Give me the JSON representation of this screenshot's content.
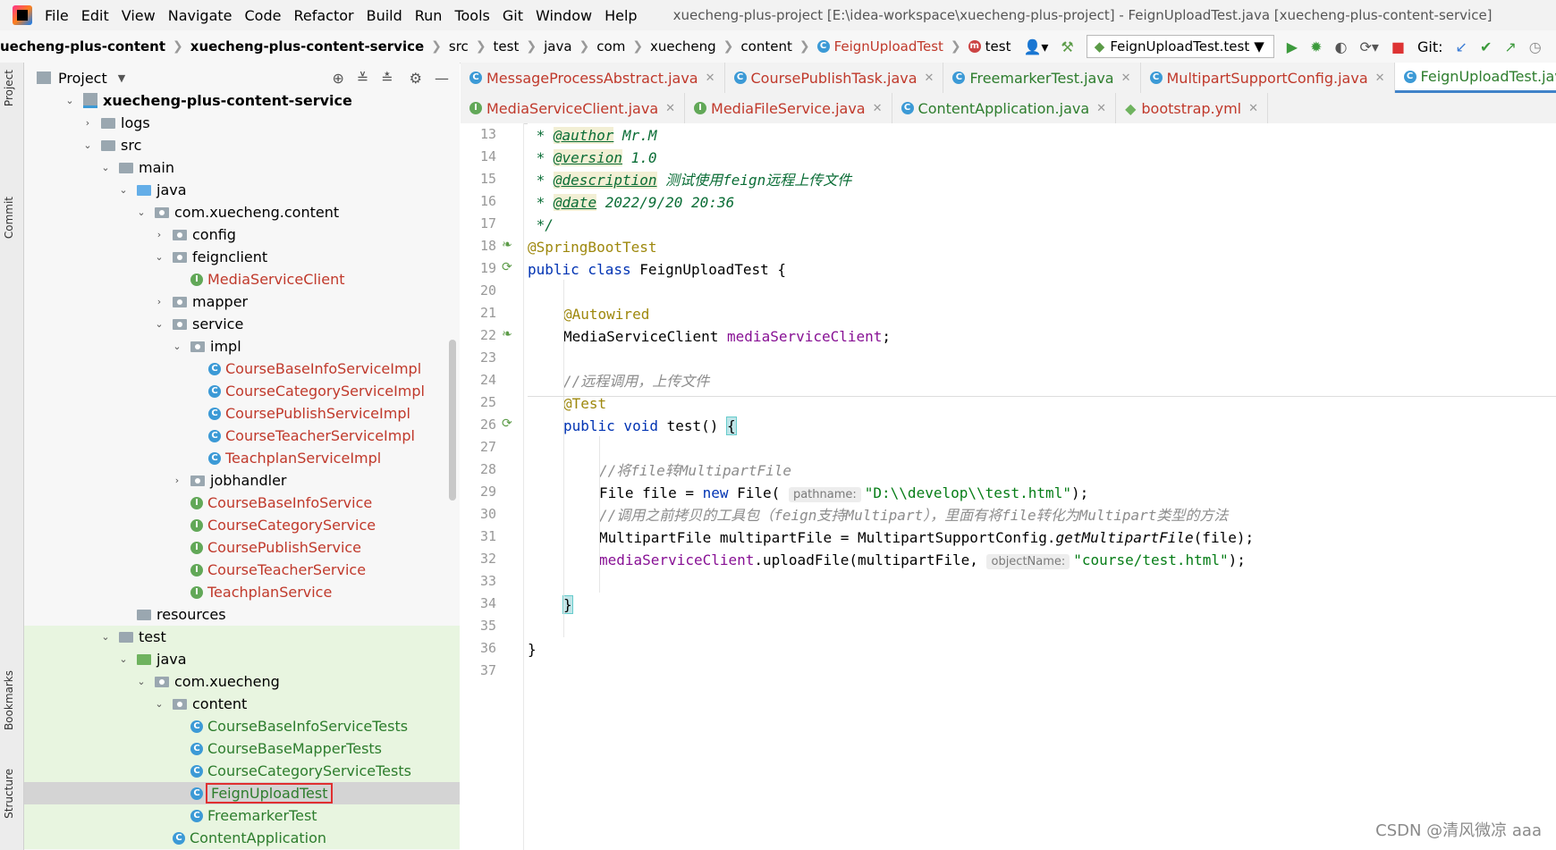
{
  "menu": [
    "File",
    "Edit",
    "View",
    "Navigate",
    "Code",
    "Refactor",
    "Build",
    "Run",
    "Tools",
    "Git",
    "Window",
    "Help"
  ],
  "window_title": "xuecheng-plus-project [E:\\idea-workspace\\xuecheng-plus-project] - FeignUploadTest.java [xuecheng-plus-content-service]",
  "breadcrumbs": [
    "uecheng-plus-content",
    "xuecheng-plus-content-service",
    "src",
    "test",
    "java",
    "com",
    "xuecheng",
    "content",
    "FeignUploadTest",
    "test"
  ],
  "run_config": "FeignUploadTest.test",
  "git_label": "Git:",
  "project_panel": {
    "title": "Project"
  },
  "left_strip": [
    "Project",
    "Commit",
    "Bookmarks",
    "Structure"
  ],
  "tree": [
    {
      "label": "xuecheng-plus-content-service",
      "depth": 0,
      "kind": "module",
      "open": true,
      "bold": true
    },
    {
      "label": "logs",
      "depth": 1,
      "kind": "folder",
      "open": false
    },
    {
      "label": "src",
      "depth": 1,
      "kind": "folder",
      "open": true
    },
    {
      "label": "main",
      "depth": 2,
      "kind": "folder",
      "open": true
    },
    {
      "label": "java",
      "depth": 3,
      "kind": "src",
      "open": true
    },
    {
      "label": "com.xuecheng.content",
      "depth": 4,
      "kind": "pkg",
      "open": true
    },
    {
      "label": "config",
      "depth": 5,
      "kind": "pkg",
      "open": false
    },
    {
      "label": "feignclient",
      "depth": 5,
      "kind": "pkg",
      "open": true
    },
    {
      "label": "MediaServiceClient",
      "depth": 6,
      "kind": "interface"
    },
    {
      "label": "mapper",
      "depth": 5,
      "kind": "pkg",
      "open": false
    },
    {
      "label": "service",
      "depth": 5,
      "kind": "pkg",
      "open": true
    },
    {
      "label": "impl",
      "depth": 6,
      "kind": "pkg",
      "open": true
    },
    {
      "label": "CourseBaseInfoServiceImpl",
      "depth": 7,
      "kind": "class"
    },
    {
      "label": "CourseCategoryServiceImpl",
      "depth": 7,
      "kind": "class"
    },
    {
      "label": "CoursePublishServiceImpl",
      "depth": 7,
      "kind": "class"
    },
    {
      "label": "CourseTeacherServiceImpl",
      "depth": 7,
      "kind": "class"
    },
    {
      "label": "TeachplanServiceImpl",
      "depth": 7,
      "kind": "class"
    },
    {
      "label": "jobhandler",
      "depth": 6,
      "kind": "pkg",
      "open": false
    },
    {
      "label": "CourseBaseInfoService",
      "depth": 6,
      "kind": "interface"
    },
    {
      "label": "CourseCategoryService",
      "depth": 6,
      "kind": "interface"
    },
    {
      "label": "CoursePublishService",
      "depth": 6,
      "kind": "interface"
    },
    {
      "label": "CourseTeacherService",
      "depth": 6,
      "kind": "interface"
    },
    {
      "label": "TeachplanService",
      "depth": 6,
      "kind": "interface"
    },
    {
      "label": "resources",
      "depth": 3,
      "kind": "folder"
    },
    {
      "label": "test",
      "depth": 2,
      "kind": "folder",
      "open": true
    },
    {
      "label": "java",
      "depth": 3,
      "kind": "test-src",
      "open": true
    },
    {
      "label": "com.xuecheng",
      "depth": 4,
      "kind": "pkg",
      "open": true
    },
    {
      "label": "content",
      "depth": 5,
      "kind": "pkg",
      "open": true
    },
    {
      "label": "CourseBaseInfoServiceTests",
      "depth": 6,
      "kind": "test"
    },
    {
      "label": "CourseBaseMapperTests",
      "depth": 6,
      "kind": "test"
    },
    {
      "label": "CourseCategoryServiceTests",
      "depth": 6,
      "kind": "test"
    },
    {
      "label": "FeignUploadTest",
      "depth": 6,
      "kind": "test",
      "selected": true
    },
    {
      "label": "FreemarkerTest",
      "depth": 6,
      "kind": "test"
    },
    {
      "label": "ContentApplication",
      "depth": 5,
      "kind": "test"
    }
  ],
  "tabs_row1": [
    {
      "label": "MessageProcessAbstract.java",
      "icon": "C"
    },
    {
      "label": "CoursePublishTask.java",
      "icon": "C"
    },
    {
      "label": "FreemarkerTest.java",
      "icon": "T"
    },
    {
      "label": "MultipartSupportConfig.java",
      "icon": "C"
    },
    {
      "label": "FeignUploadTest.java",
      "icon": "T",
      "active": true
    }
  ],
  "tabs_row2": [
    {
      "label": "MediaServiceClient.java",
      "icon": "I"
    },
    {
      "label": "MediaFileService.java",
      "icon": "I"
    },
    {
      "label": "ContentApplication.java",
      "icon": "T"
    },
    {
      "label": "bootstrap.yml",
      "icon": "Y"
    }
  ],
  "code": {
    "line_numbers": [
      "13",
      "14",
      "15",
      "16",
      "17",
      "18",
      "19",
      "20",
      "21",
      "22",
      "23",
      "24",
      "25",
      "26",
      "27",
      "28",
      "29",
      "30",
      "31",
      "32",
      "33",
      "34",
      "35",
      "36",
      "37"
    ],
    "author_tag": "@author",
    "author": "Mr.M",
    "version_tag": "@version",
    "version": "1.0",
    "desc_tag": "@description",
    "desc": "测试使用feign远程上传文件",
    "date_tag": "@date",
    "date": "2022/9/20 20:36",
    "doc_end": "*/",
    "ann_boot": "@SpringBootTest",
    "class_decl_kw": "public class",
    "class_name": "FeignUploadTest {",
    "ann_autowired": "@Autowired",
    "field_type": "MediaServiceClient",
    "field_name": "mediaServiceClient",
    "field_end": ";",
    "comment_remote": "//远程调用，上传文件",
    "ann_test": "@Test",
    "method_kw": "public void",
    "method_name": "test()",
    "open_brace": "{",
    "comment_file": "//将file转MultipartFile",
    "file_decl": "File file = ",
    "new_kw": "new",
    "file_ctor": "File(",
    "hint_pathname": "pathname:",
    "path_str": "\"D:\\\\develop\\\\test.html\"",
    "stmt_end": ");",
    "comment_tool": "//调用之前拷贝的工具包（feign支持Multipart），里面有将file转化为Multipart类型的方法",
    "mp_decl": "MultipartFile multipartFile = MultipartSupportConfig.",
    "mp_method": "getMultipartFile",
    "mp_args": "(file);",
    "call_obj": "mediaServiceClient",
    "call_method": ".uploadFile(multipartFile, ",
    "hint_object": "objectName:",
    "obj_str": "\"course/test.html\"",
    "close_brace": "}"
  },
  "watermark": "CSDN @清风微凉 aaa"
}
